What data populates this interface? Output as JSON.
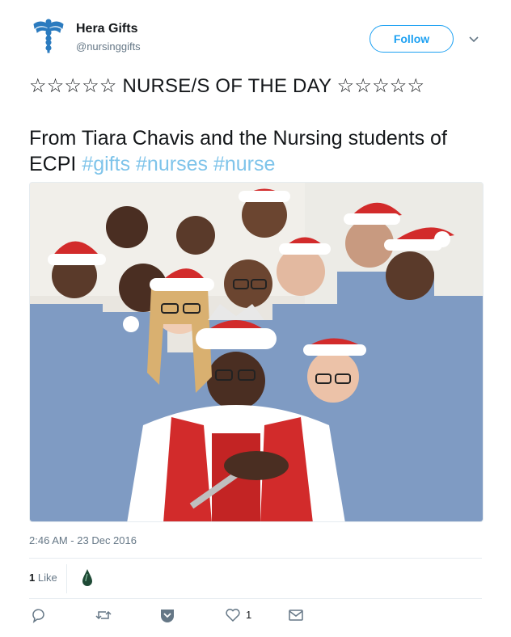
{
  "account": {
    "name": "Hera Gifts",
    "handle": "@nursinggifts",
    "avatar_icon": "caduceus-icon",
    "avatar_color": "#2b7bbf"
  },
  "follow_label": "Follow",
  "tweet": {
    "headline": "☆☆☆☆☆ NURSE/S OF THE DAY ☆☆☆☆☆",
    "text": "From Tiara Chavis and the Nursing students of ECPI",
    "hashtags": [
      "#gifts",
      "#nurses",
      "#nurse"
    ],
    "hashtag_color": "#7fc4ea"
  },
  "timestamp": "2:46 AM - 23 Dec 2016",
  "stats": {
    "like_count": "1",
    "like_label": "Like"
  },
  "actions": {
    "reply_icon": "reply-icon",
    "retweet_icon": "retweet-icon",
    "save_icon": "save-icon",
    "like_icon": "heart-icon",
    "like_count": "1",
    "message_icon": "envelope-icon"
  }
}
